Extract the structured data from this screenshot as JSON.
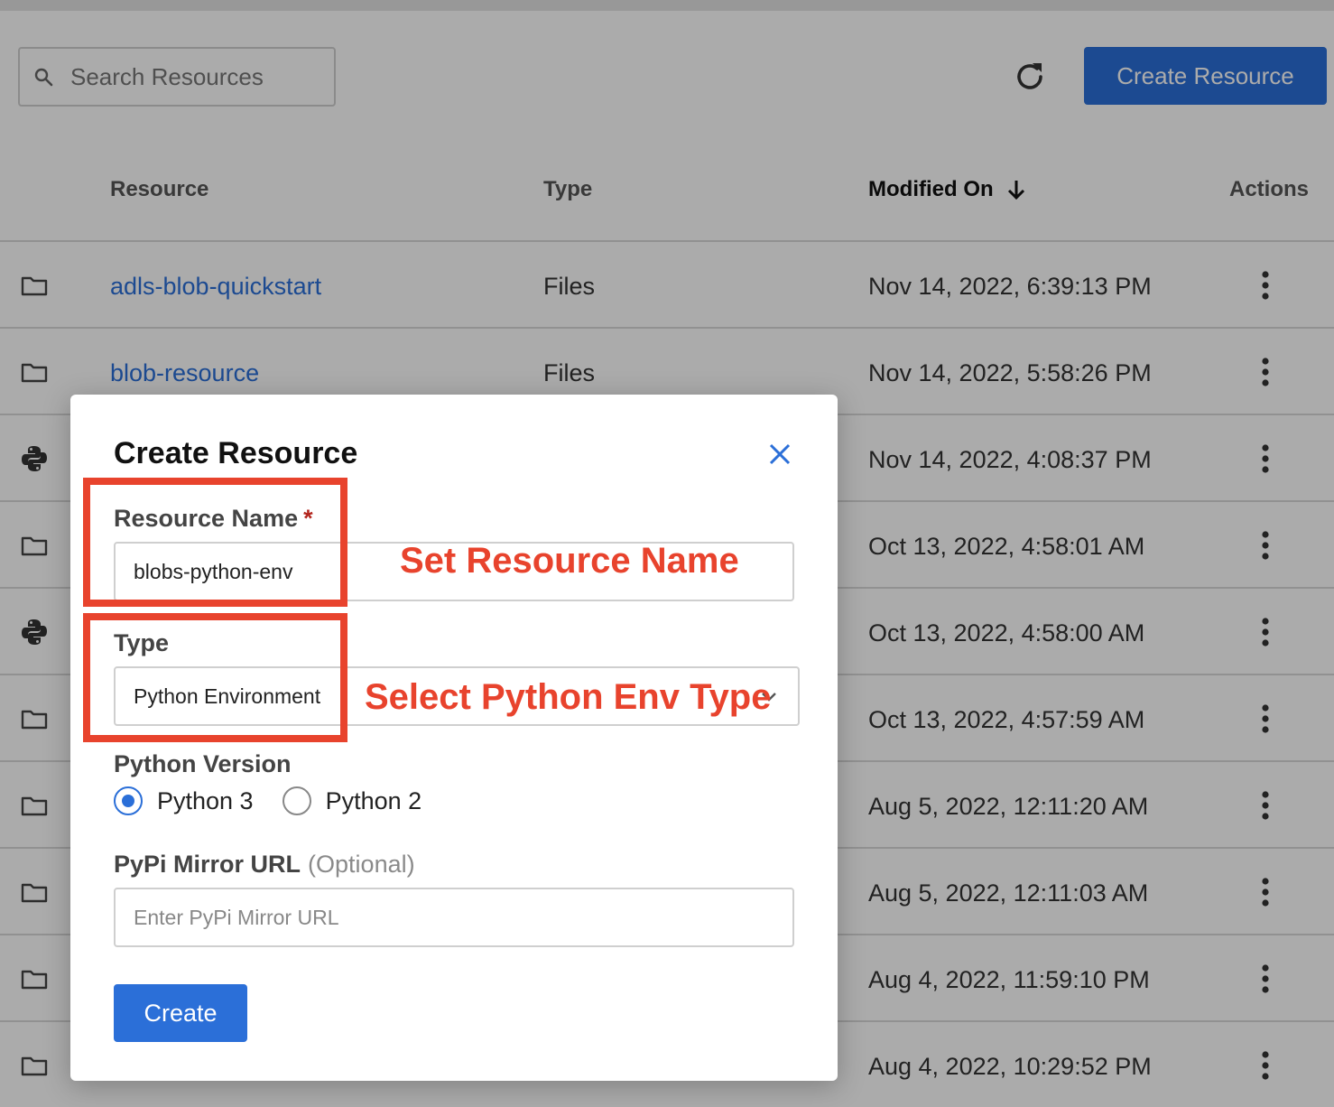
{
  "search": {
    "placeholder": "Search Resources"
  },
  "header": {
    "create_label": "Create Resource"
  },
  "table": {
    "columns": {
      "resource": "Resource",
      "type": "Type",
      "modified": "Modified On",
      "actions": "Actions"
    },
    "rows": [
      {
        "name": "adls-blob-quickstart",
        "type": "Files",
        "modified": "Nov 14, 2022, 6:39:13 PM",
        "icon": "folder-icon"
      },
      {
        "name": "blob-resource",
        "type": "Files",
        "modified": "Nov 14, 2022, 5:58:26 PM",
        "icon": "folder-icon"
      },
      {
        "name": "",
        "type": "",
        "modified": "Nov 14, 2022, 4:08:37 PM",
        "icon": "python-icon"
      },
      {
        "name": "",
        "type": "",
        "modified": "Oct 13, 2022, 4:58:01 AM",
        "icon": "folder-icon"
      },
      {
        "name": "",
        "type": "",
        "modified": "Oct 13, 2022, 4:58:00 AM",
        "icon": "python-icon"
      },
      {
        "name": "",
        "type": "",
        "modified": "Oct 13, 2022, 4:57:59 AM",
        "icon": "folder-icon"
      },
      {
        "name": "",
        "type": "",
        "modified": "Aug 5, 2022, 12:11:20 AM",
        "icon": "folder-icon"
      },
      {
        "name": "",
        "type": "",
        "modified": "Aug 5, 2022, 12:11:03 AM",
        "icon": "folder-icon"
      },
      {
        "name": "",
        "type": "",
        "modified": "Aug 4, 2022, 11:59:10 PM",
        "icon": "folder-icon"
      },
      {
        "name": "",
        "type": "",
        "modified": "Aug 4, 2022, 10:29:52 PM",
        "icon": "folder-icon"
      }
    ]
  },
  "modal": {
    "title": "Create Resource",
    "resource_name": {
      "label": "Resource Name",
      "required_mark": "*",
      "value": "blobs-python-env"
    },
    "type": {
      "label": "Type",
      "value": "Python Environment"
    },
    "python_version": {
      "label": "Python Version",
      "options": [
        "Python 3",
        "Python 2"
      ],
      "selected": "Python 3"
    },
    "pypi": {
      "label": "PyPi Mirror URL",
      "optional": "(Optional)",
      "placeholder": "Enter PyPi Mirror URL"
    },
    "create_label": "Create"
  },
  "annotations": {
    "name_note": "Set Resource Name",
    "type_note": "Select Python Env Type",
    "color": "#e8432d"
  },
  "colors": {
    "accent": "#2b6fd8",
    "link": "#2b6fd8",
    "required": "#b3261e"
  }
}
